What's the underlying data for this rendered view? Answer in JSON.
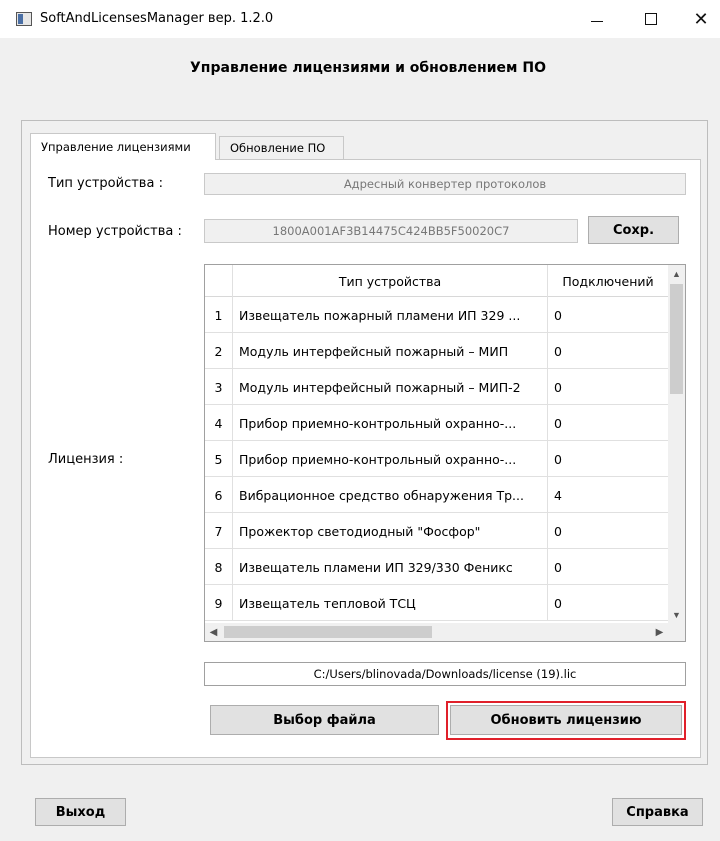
{
  "window": {
    "title": "SoftAndLicensesManager вер. 1.2.0",
    "minimize": "—",
    "maximize": "☐",
    "close": "✕",
    "icon": "app-window-icon"
  },
  "heading": "Управление лицензиями и обновлением ПО",
  "tabs": [
    {
      "label": "Управление лицензиями",
      "active": true
    },
    {
      "label": "Обновление ПО",
      "active": false
    }
  ],
  "device_type": {
    "label": "Тип устройства :",
    "value": "Адресный конвертер протоколов"
  },
  "device_number": {
    "label": "Номер устройства :",
    "value": "1800A001AF3B14475C424BB5F50020C7",
    "save_label": "Сохр."
  },
  "license": {
    "label": "Лицензия :",
    "columns": [
      "Тип устройства",
      "Подключений"
    ],
    "rows": [
      {
        "num": "1",
        "type": "Извещатель пожарный пламени ИП 329 ...",
        "connections": "0"
      },
      {
        "num": "2",
        "type": "Модуль интерфейсный пожарный – МИП",
        "connections": "0"
      },
      {
        "num": "3",
        "type": "Модуль интерфейсный пожарный – МИП-2",
        "connections": "0"
      },
      {
        "num": "4",
        "type": "Прибор приемно-контрольный охранно-...",
        "connections": "0"
      },
      {
        "num": "5",
        "type": "Прибор приемно-контрольный охранно-...",
        "connections": "0"
      },
      {
        "num": "6",
        "type": "Вибрационное средство обнаружения Тр...",
        "connections": "4"
      },
      {
        "num": "7",
        "type": "Прожектор светодиодный \"Фосфор\"",
        "connections": "0"
      },
      {
        "num": "8",
        "type": "Извещатель пламени ИП 329/330 Феникс",
        "connections": "0"
      },
      {
        "num": "9",
        "type": "Извещатель тепловой ТСЦ",
        "connections": "0"
      }
    ],
    "file_path": "C:/Users/blinovada/Downloads/license (19).lic",
    "choose_file_label": "Выбор файла",
    "update_license_label": "Обновить лицензию"
  },
  "footer": {
    "exit_label": "Выход",
    "help_label": "Справка"
  },
  "colors": {
    "highlight_border": "#e0202a",
    "background": "#f0f0f0"
  }
}
